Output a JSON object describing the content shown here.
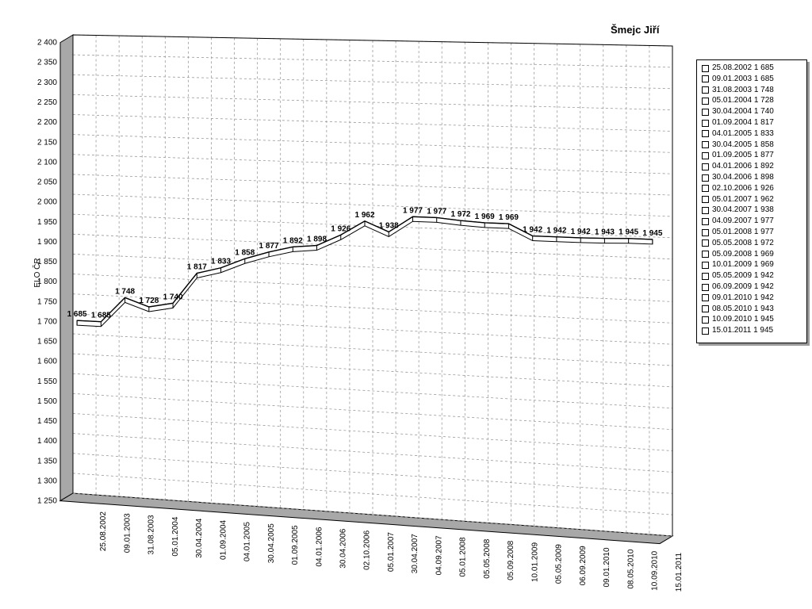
{
  "chart_data": {
    "type": "line",
    "title": "Šmejc Jiří",
    "xlabel": "",
    "ylabel": "ELO ČR",
    "ylim": [
      1250,
      2400
    ],
    "ytick_step": 50,
    "grid": true,
    "legend_position": "right",
    "categories": [
      "25.08.2002",
      "09.01.2003",
      "31.08.2003",
      "05.01.2004",
      "30.04.2004",
      "01.09.2004",
      "04.01.2005",
      "30.04.2005",
      "01.09.2005",
      "04.01.2006",
      "30.04.2006",
      "02.10.2006",
      "05.01.2007",
      "30.04.2007",
      "04.09.2007",
      "05.01.2008",
      "05.05.2008",
      "05.09.2008",
      "10.01.2009",
      "05.05.2009",
      "06.09.2009",
      "09.01.2010",
      "08.05.2010",
      "10.09.2010",
      "15.01.2011"
    ],
    "series": [
      {
        "values": [
          1685,
          1685,
          1748,
          1728,
          1740,
          1817,
          1833,
          1858,
          1877,
          1892,
          1898,
          1926,
          1962,
          1938,
          1977,
          1977,
          1972,
          1969,
          1969,
          1942,
          1942,
          1942,
          1943,
          1945,
          1945
        ]
      }
    ],
    "data_labels": [
      "1 685",
      "1 685",
      "1 748",
      "1 728",
      "1 740",
      "1 817",
      "1 833",
      "1 858",
      "1 877",
      "1 892",
      "1 898",
      "1 926",
      "1 962",
      "1 938",
      "1 977",
      "1 977",
      "1 972",
      "1 969",
      "1 969",
      "1 942",
      "1 942",
      "1 942",
      "1 943",
      "1 945",
      "1 945"
    ],
    "ytick_labels": [
      "1 250",
      "1 300",
      "1 350",
      "1 400",
      "1 450",
      "1 500",
      "1 550",
      "1 600",
      "1 650",
      "1 700",
      "1 750",
      "1 800",
      "1 850",
      "1 900",
      "1 950",
      "2 000",
      "2 050",
      "2 100",
      "2 150",
      "2 200",
      "2 250",
      "2 300",
      "2 350",
      "2 400"
    ],
    "legend_entries": [
      "25.08.2002 1 685",
      "09.01.2003 1 685",
      "31.08.2003 1 748",
      "05.01.2004 1 728",
      "30.04.2004 1 740",
      "01.09.2004 1 817",
      "04.01.2005 1 833",
      "30.04.2005 1 858",
      "01.09.2005 1 877",
      "04.01.2006 1 892",
      "30.04.2006 1 898",
      "02.10.2006 1 926",
      "05.01.2007 1 962",
      "30.04.2007 1 938",
      "04.09.2007 1 977",
      "05.01.2008 1 977",
      "05.05.2008 1 972",
      "05.09.2008 1 969",
      "10.01.2009 1 969",
      "05.05.2009 1 942",
      "06.09.2009 1 942",
      "09.01.2010 1 942",
      "08.05.2010 1 943",
      "10.09.2010 1 945",
      "15.01.2011 1 945"
    ],
    "colors": {
      "line": "#000000",
      "fill": "#ffffff",
      "grid": "#9a9a9a",
      "wall_shadow": "#a8a8a8"
    }
  }
}
